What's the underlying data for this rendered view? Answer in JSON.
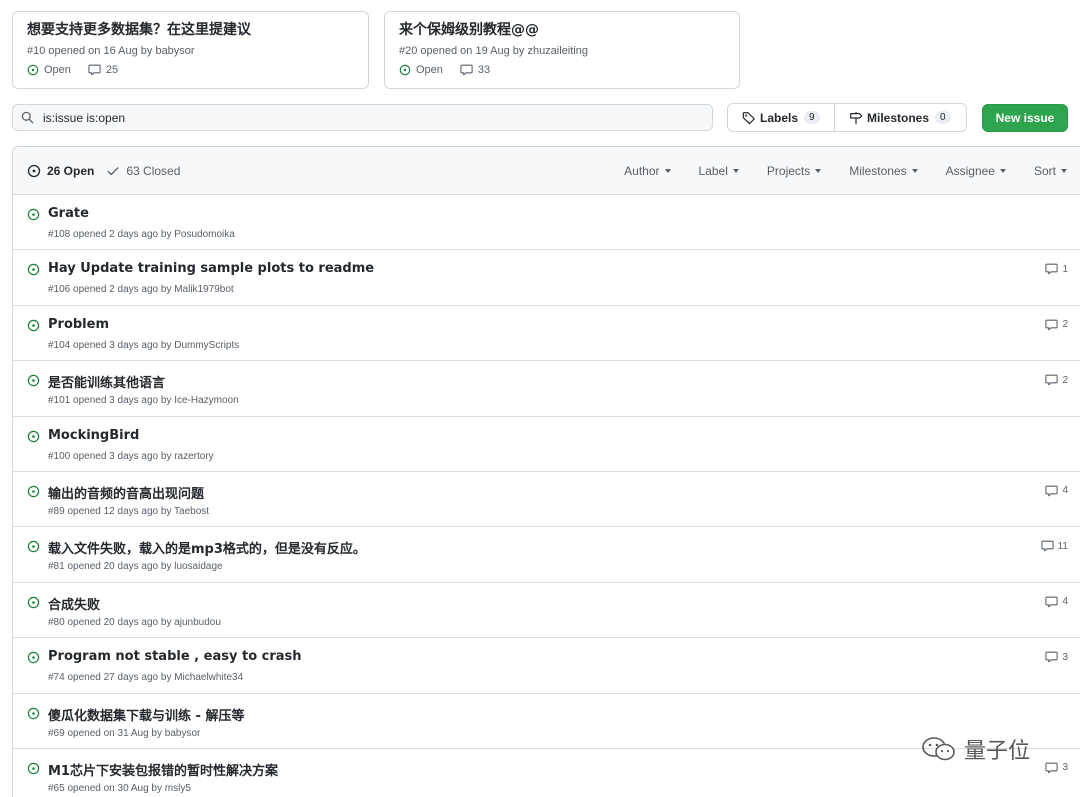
{
  "pinned": [
    {
      "title": "想要支持更多数据集？在这里提建议",
      "meta": "#10 opened on 16 Aug by babysor",
      "status": "Open",
      "comments": "25"
    },
    {
      "title": "来个保姆级别教程@@",
      "meta": "#20 opened on 19 Aug by zhuzaileiting",
      "status": "Open",
      "comments": "33"
    }
  ],
  "search": {
    "value": "is:issue is:open"
  },
  "labels": {
    "label": "Labels",
    "count": "9"
  },
  "milestones": {
    "label": "Milestones",
    "count": "0"
  },
  "new_issue": {
    "label": "New issue"
  },
  "header": {
    "open": "26 Open",
    "closed": "63 Closed",
    "filters": [
      "Author",
      "Label",
      "Projects",
      "Milestones",
      "Assignee",
      "Sort"
    ]
  },
  "issues": [
    {
      "title": "Grate",
      "meta": "#108 opened 2 days ago by Posudomoika",
      "comments": ""
    },
    {
      "title": "Hay Update training sample plots to readme",
      "meta": "#106 opened 2 days ago by Malik1979bot",
      "comments": "1"
    },
    {
      "title": "Problem",
      "meta": "#104 opened 3 days ago by DummyScripts",
      "comments": "2"
    },
    {
      "title": "是否能训练其他语言",
      "meta": "#101 opened 3 days ago by Ice-Hazymoon",
      "comments": "2"
    },
    {
      "title": "MockingBird",
      "meta": "#100 opened 3 days ago by razertory",
      "comments": ""
    },
    {
      "title": "输出的音频的音高出现问题",
      "meta": "#89 opened 12 days ago by Taebost",
      "comments": "4"
    },
    {
      "title": "载入文件失败，载入的是mp3格式的，但是没有反应。",
      "meta": "#81 opened 20 days ago by luosaidage",
      "comments": "11"
    },
    {
      "title": "合成失败",
      "meta": "#80 opened 20 days ago by ajunbudou",
      "comments": "4"
    },
    {
      "title": "Program not stable , easy to crash",
      "meta": "#74 opened 27 days ago by Michaelwhite34",
      "comments": "3"
    },
    {
      "title": "傻瓜化数据集下载与训练 - 解压等",
      "meta": "#69 opened on 31 Aug by babysor",
      "comments": ""
    },
    {
      "title": "M1芯片下安装包报错的暂时性解决方案",
      "meta": "#65 opened on 30 Aug by msly5",
      "comments": "3"
    }
  ],
  "watermark": {
    "text": "量子位"
  },
  "colors": {
    "open_green": "#1a7f37",
    "button_green": "#2da44e",
    "muted": "#57606a"
  }
}
